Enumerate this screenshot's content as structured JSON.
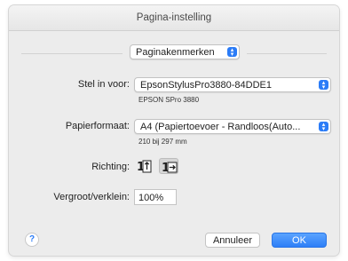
{
  "window": {
    "title": "Pagina-instelling"
  },
  "settings_popup": {
    "value": "Paginakenmerken"
  },
  "format_for": {
    "label": "Stel in voor:",
    "value": "EpsonStylusPro3880-84DDE1",
    "sub": "EPSON SPro 3880"
  },
  "paper_size": {
    "label": "Papierformaat:",
    "value": "A4 (Papiertoevoer - Randloos(Auto...",
    "sub": "210 bij 297 mm"
  },
  "orientation": {
    "label": "Richting:",
    "options": [
      "portrait",
      "landscape"
    ],
    "selected": "landscape"
  },
  "scale": {
    "label": "Vergroot/verklein:",
    "value": "100%"
  },
  "footer": {
    "help": "?",
    "cancel_label": "Annuleer",
    "ok_label": "OK"
  },
  "colors": {
    "accent": "#2b7cf7"
  }
}
